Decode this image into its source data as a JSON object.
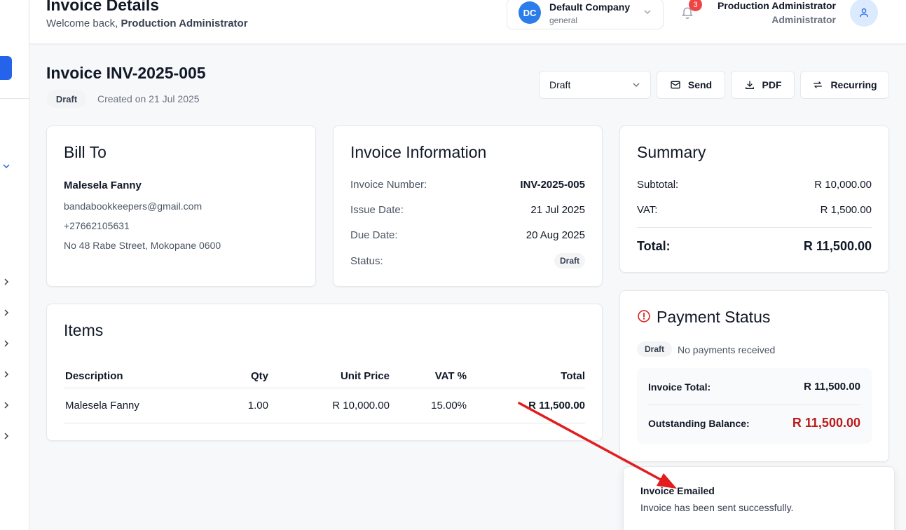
{
  "header": {
    "title": "Invoice Details",
    "welcome_prefix": "Welcome back, ",
    "welcome_user": "Production Administrator",
    "company": {
      "initials": "DC",
      "name": "Default Company",
      "sub": "general"
    },
    "notifications_count": "3",
    "user": {
      "name": "Production Administrator",
      "role": "Administrator"
    }
  },
  "invoice": {
    "title": "Invoice INV-2025-005",
    "status_badge": "Draft",
    "created": "Created on 21 Jul 2025"
  },
  "toolbar": {
    "status_value": "Draft",
    "send_label": "Send",
    "pdf_label": "PDF",
    "recurring_label": "Recurring"
  },
  "bill_to": {
    "title": "Bill To",
    "name": "Malesela Fanny",
    "email": "bandabookkeepers@gmail.com",
    "phone": "+27662105631",
    "address": "No 48 Rabe Street, Mokopane 0600"
  },
  "invoice_info": {
    "title": "Invoice Information",
    "number_label": "Invoice Number:",
    "number_value": "INV-2025-005",
    "issue_label": "Issue Date:",
    "issue_value": "21 Jul 2025",
    "due_label": "Due Date:",
    "due_value": "20 Aug 2025",
    "status_label": "Status:",
    "status_value": "Draft"
  },
  "summary": {
    "title": "Summary",
    "subtotal_label": "Subtotal:",
    "subtotal_value": "R 10,000.00",
    "vat_label": "VAT:",
    "vat_value": "R 1,500.00",
    "total_label": "Total:",
    "total_value": "R 11,500.00"
  },
  "items": {
    "title": "Items",
    "columns": [
      "Description",
      "Qty",
      "Unit Price",
      "VAT %",
      "Total"
    ],
    "rows": [
      {
        "description": "Malesela Fanny",
        "qty": "1.00",
        "unit_price": "R 10,000.00",
        "vat": "15.00%",
        "total": "R 11,500.00"
      }
    ]
  },
  "payment_status": {
    "title": "Payment Status",
    "badge": "Draft",
    "note": "No payments received",
    "invoice_total_label": "Invoice Total:",
    "invoice_total_value": "R 11,500.00",
    "outstanding_label": "Outstanding Balance:",
    "outstanding_value": "R 11,500.00"
  },
  "toast": {
    "title": "Invoice Emailed",
    "message": "Invoice has been sent successfully."
  },
  "colors": {
    "accent": "#2563eb",
    "danger": "#b91c1c",
    "annotation_arrow": "#e11d1d"
  }
}
